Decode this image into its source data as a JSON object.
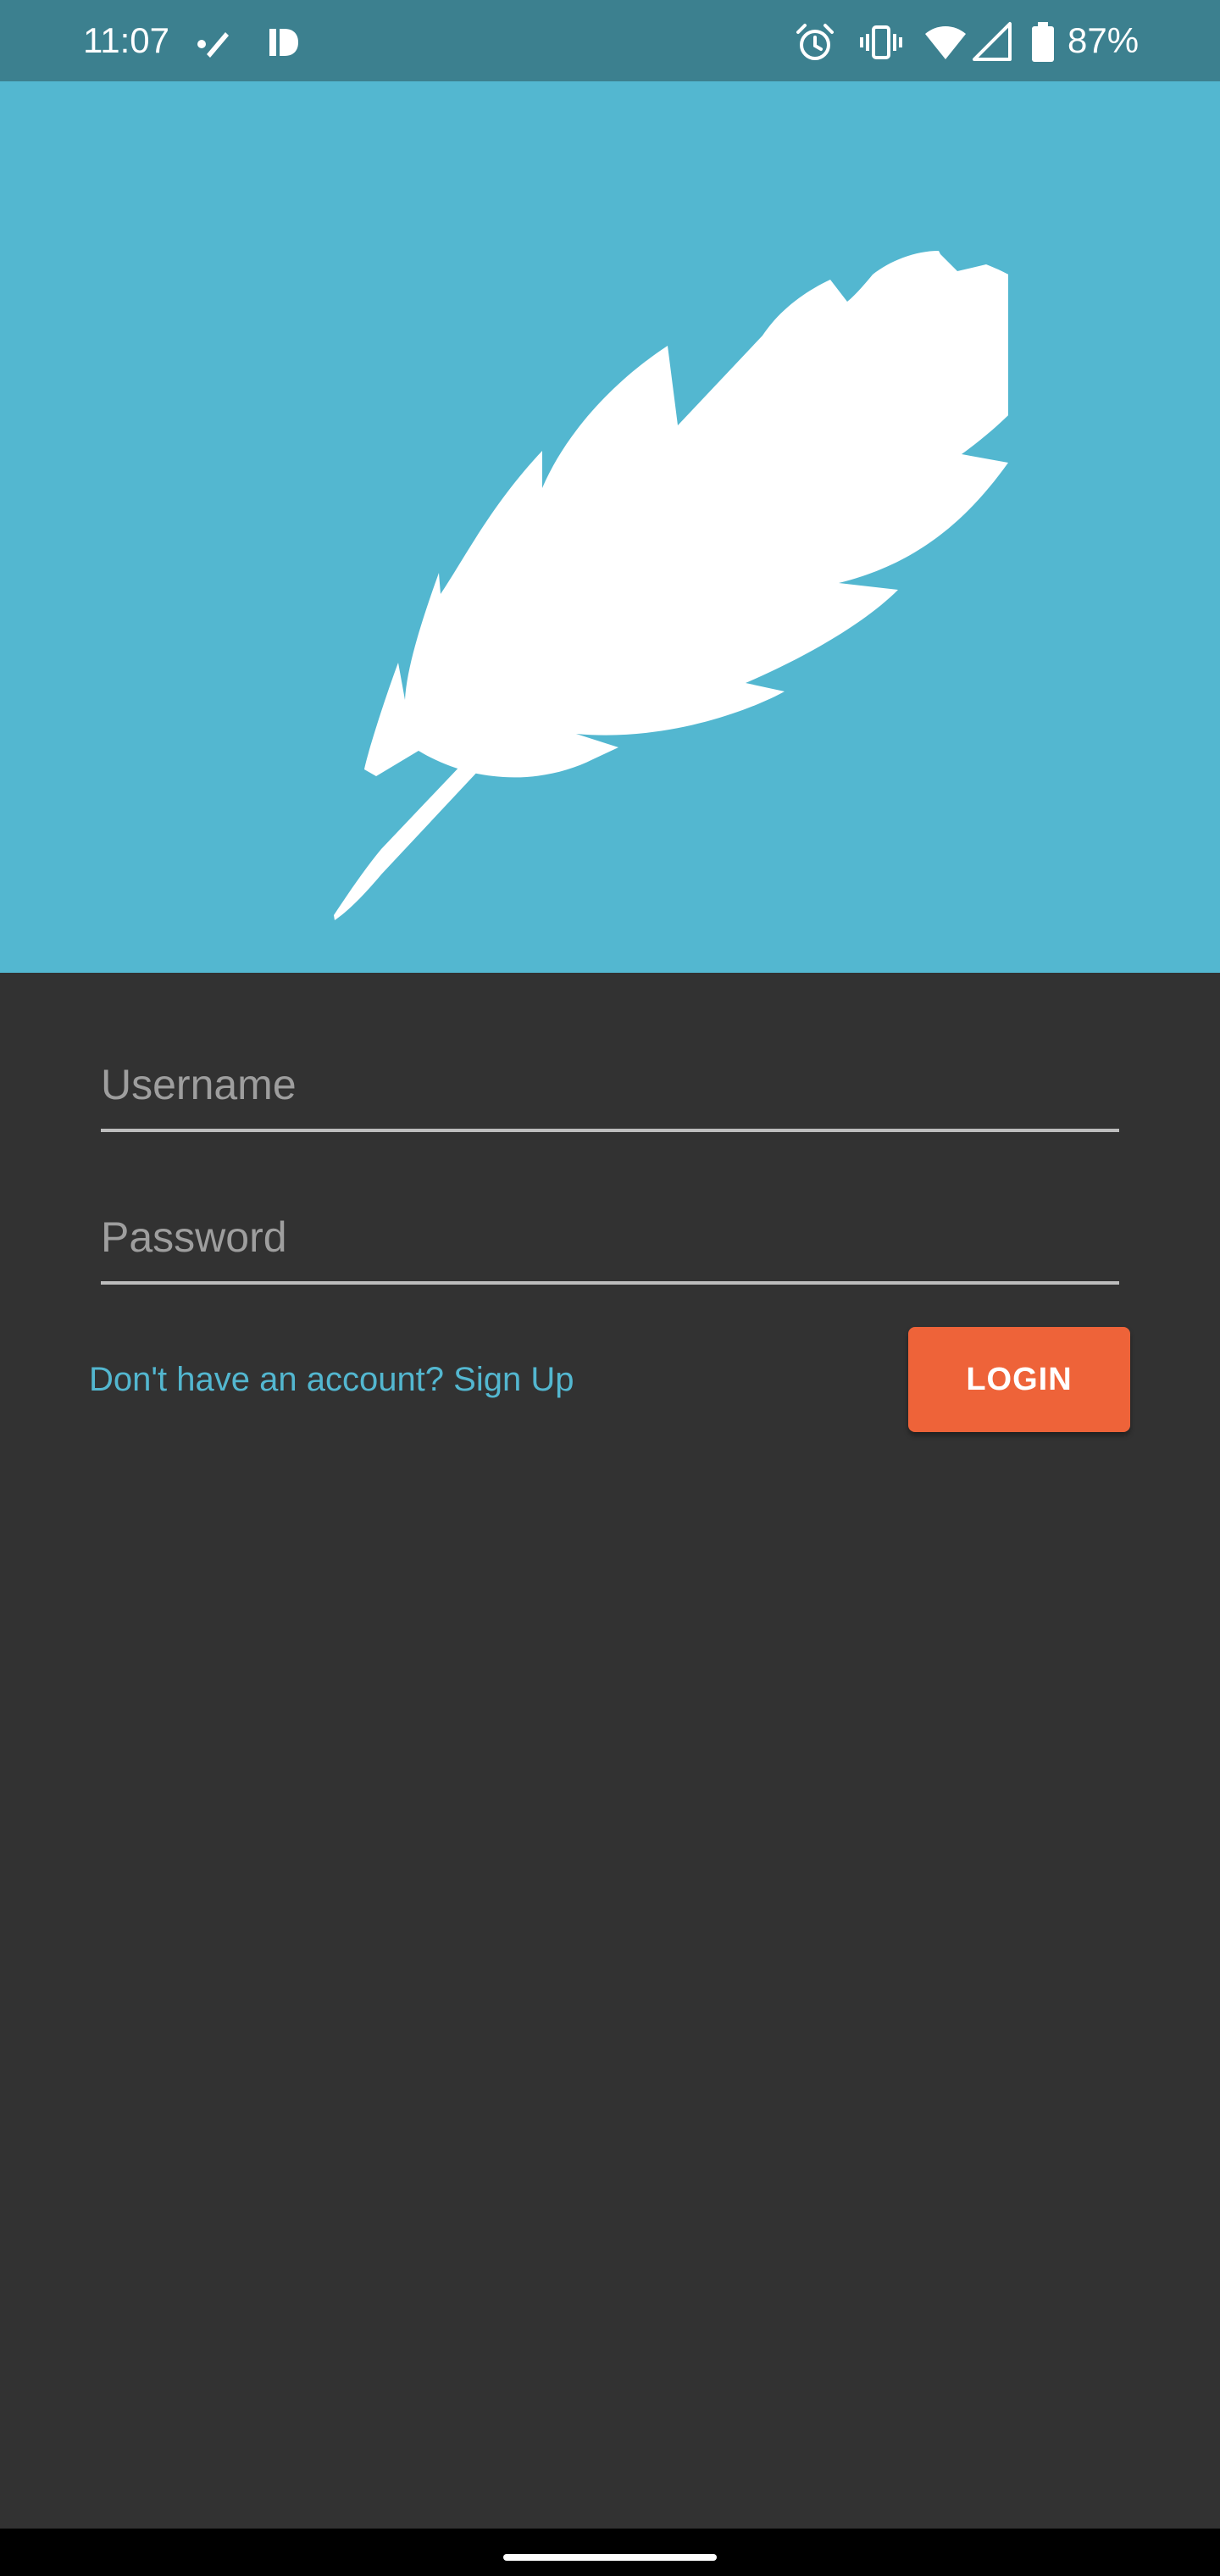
{
  "status_bar": {
    "time": "11:07",
    "battery_percent": "87%",
    "battery_level": 0.87,
    "left_icons": [
      "pen-tool-icon",
      "pandora-app-icon"
    ],
    "right_icons": [
      "alarm-clock-icon",
      "vibrate-icon",
      "wifi-icon",
      "cell-signal-icon",
      "battery-icon"
    ],
    "background_color": "#3C808F"
  },
  "hero": {
    "logo_icon": "feather-icon",
    "background_color": "#53B7D0"
  },
  "login_form": {
    "username": {
      "placeholder": "Username",
      "value": ""
    },
    "password": {
      "placeholder": "Password",
      "value": ""
    },
    "signup_link": "Don't have an account? Sign Up",
    "login_button": "LOGIN"
  },
  "colors": {
    "page_background": "#323232",
    "accent": "#53B7D0",
    "login_button": "#EE6339",
    "placeholder_text": "#9E9E9E"
  }
}
